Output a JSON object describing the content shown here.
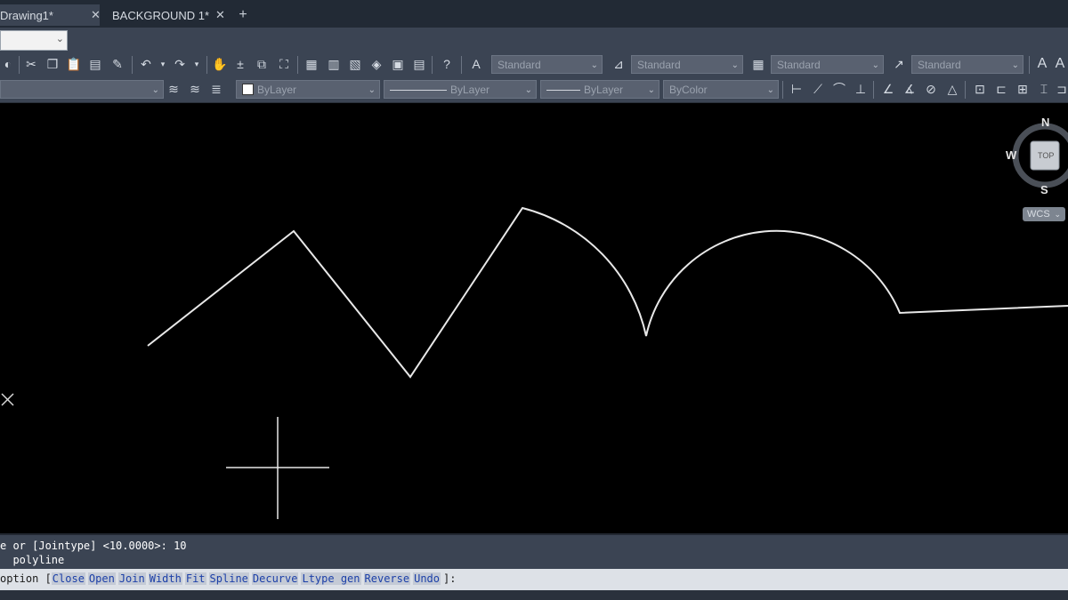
{
  "tabs": [
    {
      "label": "Drawing1*",
      "close": "✕",
      "active": true
    },
    {
      "label": "BACKGROUND 1*",
      "close": "✕",
      "active": false
    }
  ],
  "new_tab_label": "+",
  "toolbar": {
    "text_style": "Standard",
    "dim_style": "Standard",
    "table_style": "Standard",
    "mleader_style": "Standard",
    "color": "ByLayer",
    "linetype": "ByLayer",
    "lineweight": "ByLayer",
    "plot_style": "ByColor"
  },
  "viewcube": {
    "north": "N",
    "south": "S",
    "west": "W",
    "face": "TOP"
  },
  "ucs_label": "WCS",
  "command_history": [
    "e or [Jointype] <10.0000>: 10",
    "  polyline"
  ],
  "command_prompt": {
    "prefix": " option [",
    "options": [
      "Close",
      "Open",
      "Join",
      "Width",
      "Fit",
      "Spline",
      "Decurve",
      "Ltype gen",
      "Reverse",
      "Undo"
    ],
    "suffix": "]:"
  },
  "colors": {
    "canvas": "#000000",
    "chrome": "#3b4453",
    "tabstrip": "#222a35",
    "option_keyword": "#1b3fa8",
    "geometry": "#e8e8e8"
  }
}
